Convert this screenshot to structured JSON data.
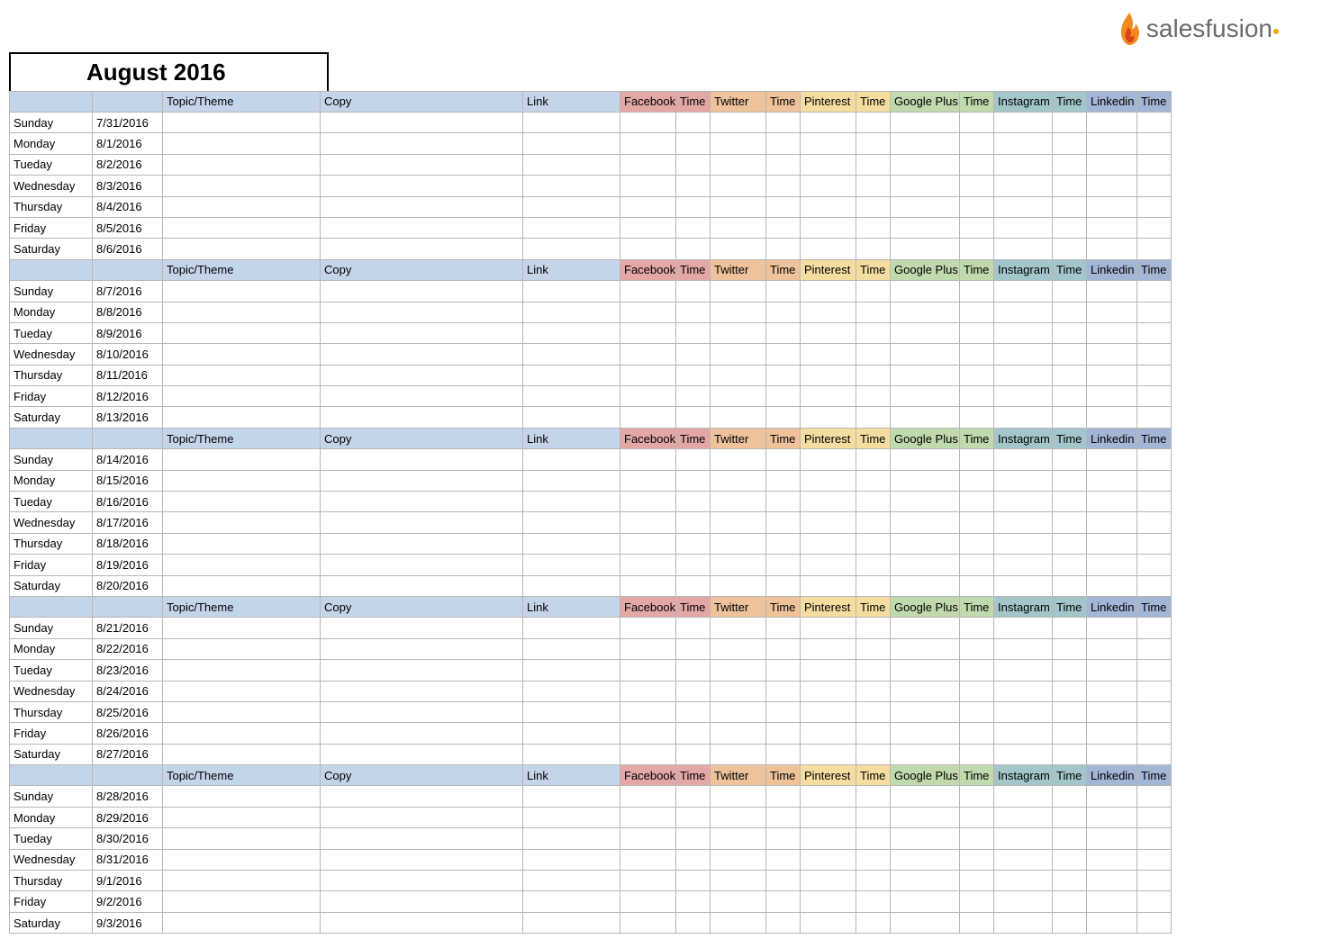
{
  "logo": {
    "text_sales": "sales",
    "text_fusion": "fusion"
  },
  "title": "August 2016",
  "headers": {
    "topic": "Topic/Theme",
    "copy": "Copy",
    "link": "Link",
    "facebook": "Facebook",
    "twitter": "Twitter",
    "pinterest": "Pinterest",
    "google_plus": "Google Plus",
    "instagram": "Instagram",
    "linkedin": "Linkedin",
    "time": "Time"
  },
  "weeks": [
    {
      "days": [
        {
          "name": "Sunday",
          "date": "7/31/2016"
        },
        {
          "name": "Monday",
          "date": "8/1/2016"
        },
        {
          "name": "Tueday",
          "date": "8/2/2016"
        },
        {
          "name": "Wednesday",
          "date": "8/3/2016"
        },
        {
          "name": "Thursday",
          "date": "8/4/2016"
        },
        {
          "name": "Friday",
          "date": "8/5/2016"
        },
        {
          "name": "Saturday",
          "date": "8/6/2016"
        }
      ]
    },
    {
      "days": [
        {
          "name": "Sunday",
          "date": "8/7/2016"
        },
        {
          "name": "Monday",
          "date": "8/8/2016"
        },
        {
          "name": "Tueday",
          "date": "8/9/2016"
        },
        {
          "name": "Wednesday",
          "date": "8/10/2016"
        },
        {
          "name": "Thursday",
          "date": "8/11/2016"
        },
        {
          "name": "Friday",
          "date": "8/12/2016"
        },
        {
          "name": "Saturday",
          "date": "8/13/2016"
        }
      ]
    },
    {
      "days": [
        {
          "name": "Sunday",
          "date": "8/14/2016"
        },
        {
          "name": "Monday",
          "date": "8/15/2016"
        },
        {
          "name": "Tueday",
          "date": "8/16/2016"
        },
        {
          "name": "Wednesday",
          "date": "8/17/2016"
        },
        {
          "name": "Thursday",
          "date": "8/18/2016"
        },
        {
          "name": "Friday",
          "date": "8/19/2016"
        },
        {
          "name": "Saturday",
          "date": "8/20/2016"
        }
      ]
    },
    {
      "days": [
        {
          "name": "Sunday",
          "date": "8/21/2016"
        },
        {
          "name": "Monday",
          "date": "8/22/2016"
        },
        {
          "name": "Tueday",
          "date": "8/23/2016"
        },
        {
          "name": "Wednesday",
          "date": "8/24/2016"
        },
        {
          "name": "Thursday",
          "date": "8/25/2016"
        },
        {
          "name": "Friday",
          "date": "8/26/2016"
        },
        {
          "name": "Saturday",
          "date": "8/27/2016"
        }
      ]
    },
    {
      "days": [
        {
          "name": "Sunday",
          "date": "8/28/2016"
        },
        {
          "name": "Monday",
          "date": "8/29/2016"
        },
        {
          "name": "Tueday",
          "date": "8/30/2016"
        },
        {
          "name": "Wednesday",
          "date": "8/31/2016"
        },
        {
          "name": "Thursday",
          "date": "9/1/2016"
        },
        {
          "name": "Friday",
          "date": "9/2/2016"
        },
        {
          "name": "Saturday",
          "date": "9/3/2016"
        }
      ]
    }
  ]
}
